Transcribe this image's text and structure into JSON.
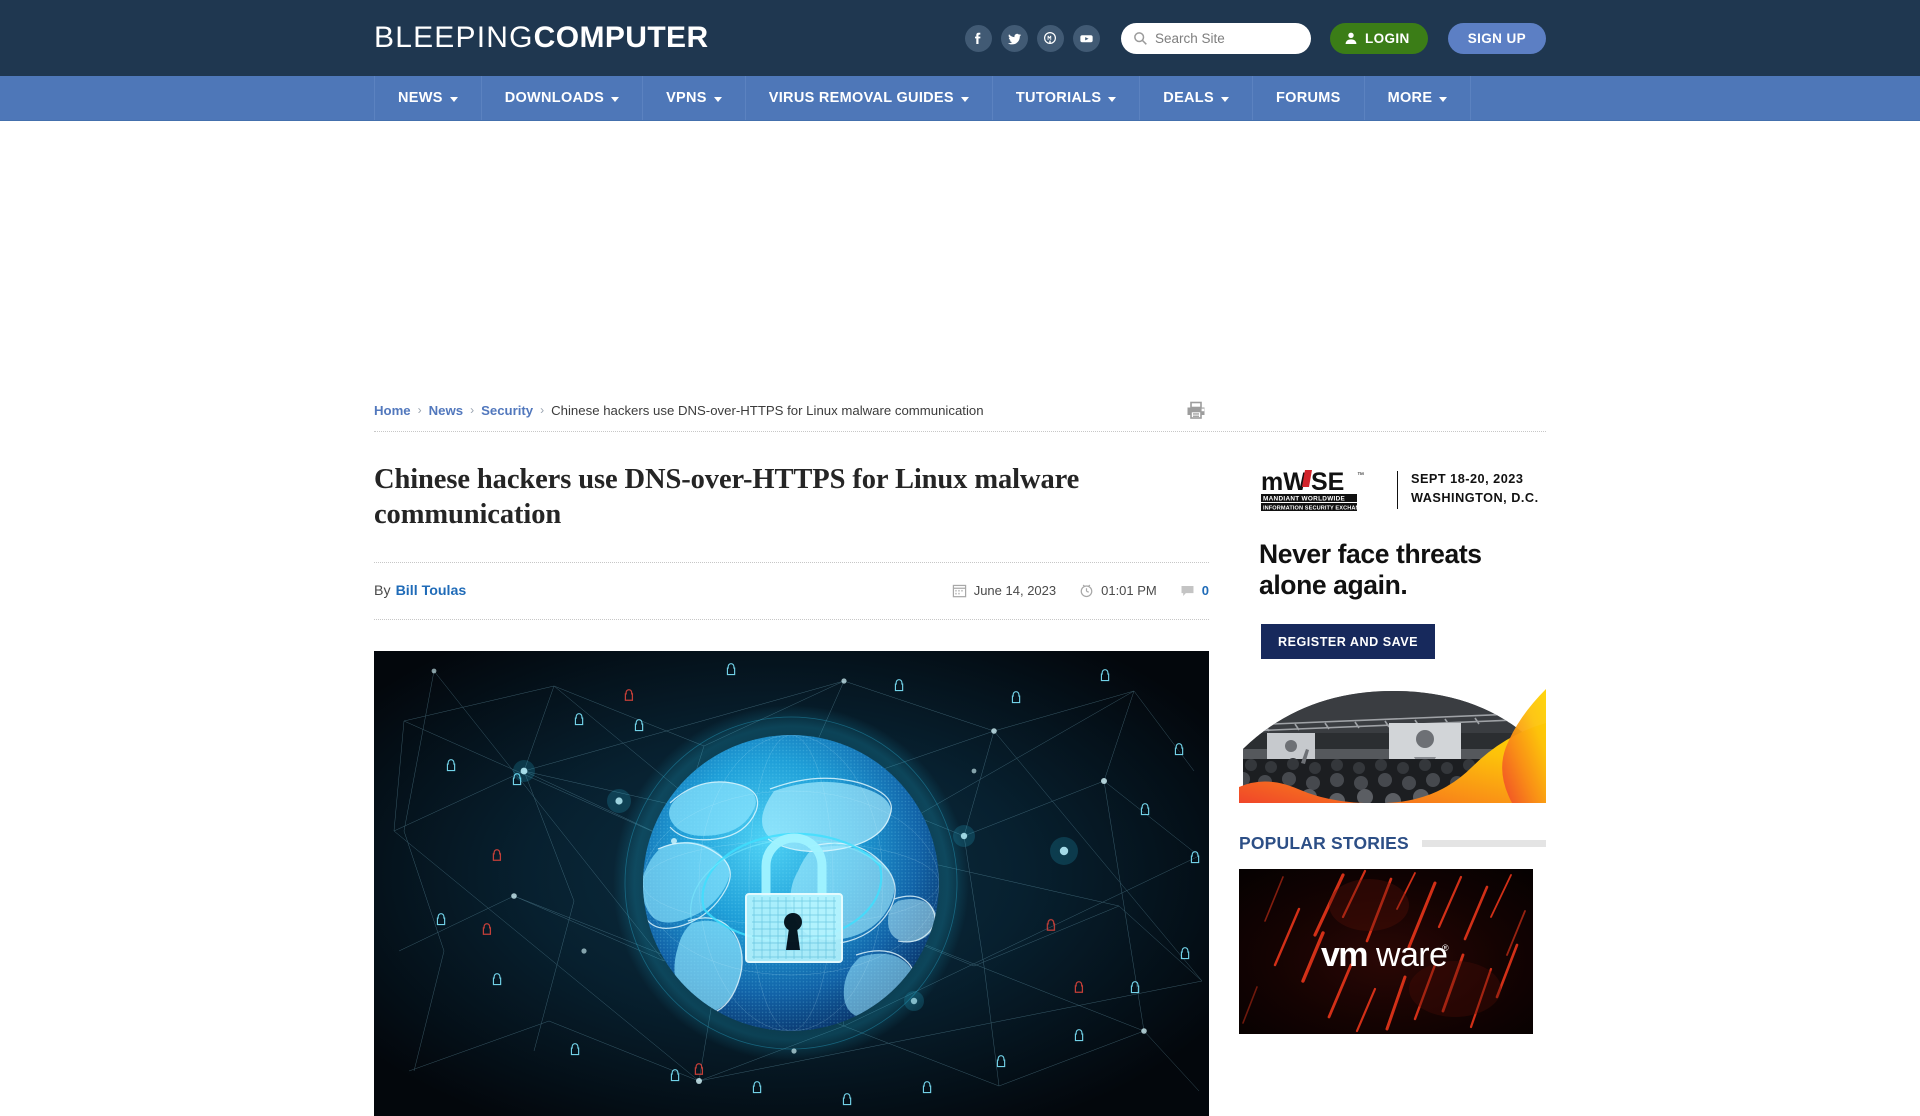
{
  "site": {
    "logo_light": "BLEEPING",
    "logo_bold": "COMPUTER",
    "header_bg": "#1f3750",
    "nav_bg": "#4e77b8",
    "accent_blue": "#5278bd",
    "login_green": "#3b7d17",
    "signup_blue": "#5c7fc4"
  },
  "social": [
    {
      "name": "facebook-icon",
      "label": "Facebook"
    },
    {
      "name": "twitter-icon",
      "label": "Twitter"
    },
    {
      "name": "mastodon-icon",
      "label": "Mastodon"
    },
    {
      "name": "youtube-icon",
      "label": "YouTube"
    }
  ],
  "search": {
    "placeholder": "Search Site",
    "value": "",
    "icon": "search-icon"
  },
  "auth": {
    "login_label": "LOGIN",
    "login_icon": "user-icon",
    "signup_label": "SIGN UP"
  },
  "nav": [
    {
      "label": "NEWS",
      "has_dropdown": true
    },
    {
      "label": "DOWNLOADS",
      "has_dropdown": true
    },
    {
      "label": "VPNS",
      "has_dropdown": true
    },
    {
      "label": "VIRUS REMOVAL GUIDES",
      "has_dropdown": true
    },
    {
      "label": "TUTORIALS",
      "has_dropdown": true
    },
    {
      "label": "DEALS",
      "has_dropdown": true
    },
    {
      "label": "FORUMS",
      "has_dropdown": false
    },
    {
      "label": "MORE",
      "has_dropdown": true
    }
  ],
  "breadcrumb": {
    "items": [
      "Home",
      "News",
      "Security"
    ],
    "separator": "›",
    "current": "Chinese hackers use DNS-over-HTTPS for Linux malware communication",
    "print_icon": "printer-icon"
  },
  "article": {
    "title": "Chinese hackers use DNS-over-HTTPS for Linux malware communication",
    "by_label": "By",
    "author": "Bill Toulas",
    "date": "June 14, 2023",
    "date_icon": "calendar-icon",
    "time": "01:01 PM",
    "time_icon": "clock-icon",
    "comment_icon": "comment-icon",
    "comment_count": "0",
    "hero_alt": "Digital globe with padlock over network mesh"
  },
  "sidebar": {
    "ad": {
      "logo_text": "mWiSE",
      "logo_sub_1": "MANDIANT WORLDWIDE",
      "logo_sub_2": "INFORMATION SECURITY EXCHANGE",
      "dates": "SEPT 18-20, 2023",
      "location": "WASHINGTON, D.C.",
      "headline": "Never face threats alone again.",
      "cta": "REGISTER AND SAVE",
      "photo_alt": "Conference audience watching keynote speaker"
    },
    "popular": {
      "heading": "POPULAR STORIES",
      "thumb_label": "vmware",
      "thumb_reg": "®"
    }
  }
}
